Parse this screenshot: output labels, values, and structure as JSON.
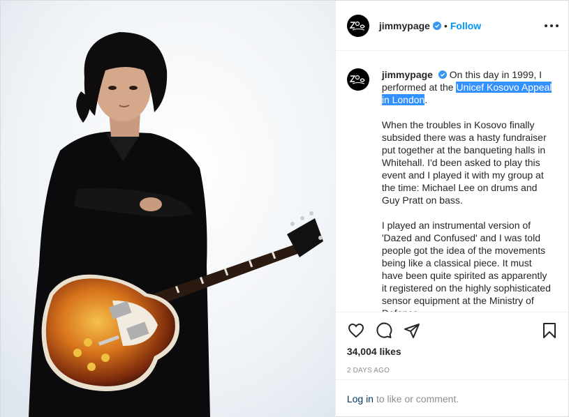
{
  "post": {
    "username": "jimmypage",
    "follow_label": "Follow",
    "dot": "•",
    "caption": {
      "intro_before": "On this day in 1999, I performed at the ",
      "intro_highlight": "Unicef Kosovo Appeal in London",
      "intro_after": ".",
      "para1": "When the troubles in Kosovo finally subsided there was a hasty fundraiser put together at the banqueting halls in Whitehall. I'd been asked to play this event and I played it with my group at the time: Michael Lee on drums and Guy Pratt on bass.",
      "para2": "I played an instrumental version of 'Dazed and Confused' and I was told people got the idea of the movements being like a classical piece. It must have been quite spirited as apparently it registered on the highly sophisticated sensor equipment at the Ministry of Defence"
    },
    "likes": "34,004 likes",
    "timestamp": "2 DAYS AGO",
    "login_link": "Log in",
    "login_text": "to like or comment."
  },
  "icons": {
    "verified": "verified-badge-icon",
    "more": "more-options-icon",
    "like": "heart-icon",
    "comment": "comment-icon",
    "share": "share-icon",
    "save": "bookmark-icon"
  },
  "colors": {
    "link_blue": "#0095f6",
    "verified_blue": "#3897f0",
    "selection": "#3390ff",
    "muted": "#8e8e8e"
  }
}
